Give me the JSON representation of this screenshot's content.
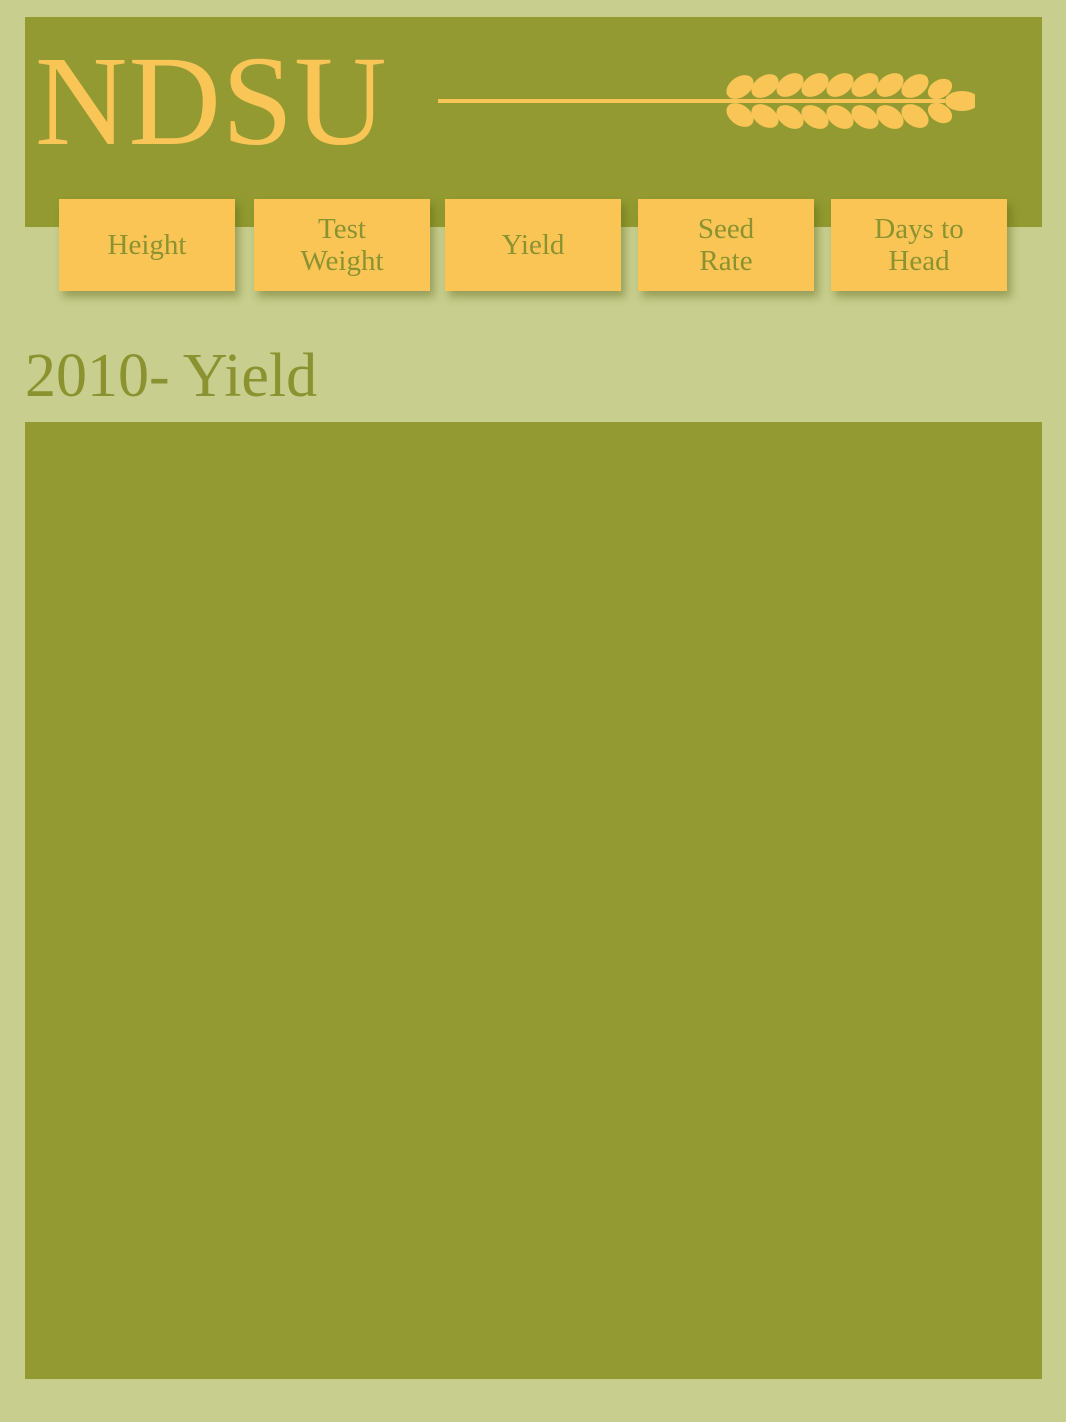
{
  "header": {
    "logo_text": "NDSU",
    "emblem_icon": "wheat-icon"
  },
  "nav": {
    "items": [
      {
        "label": "Height"
      },
      {
        "label": "Test\nWeight"
      },
      {
        "label": "Yield"
      },
      {
        "label": "Seed\nRate"
      },
      {
        "label": "Days to\nHead"
      }
    ]
  },
  "main": {
    "title": "2010- Yield"
  },
  "colors": {
    "background": "#c7ce8e",
    "panel": "#929a31",
    "accent": "#fac555",
    "text_green": "#8a9330"
  }
}
